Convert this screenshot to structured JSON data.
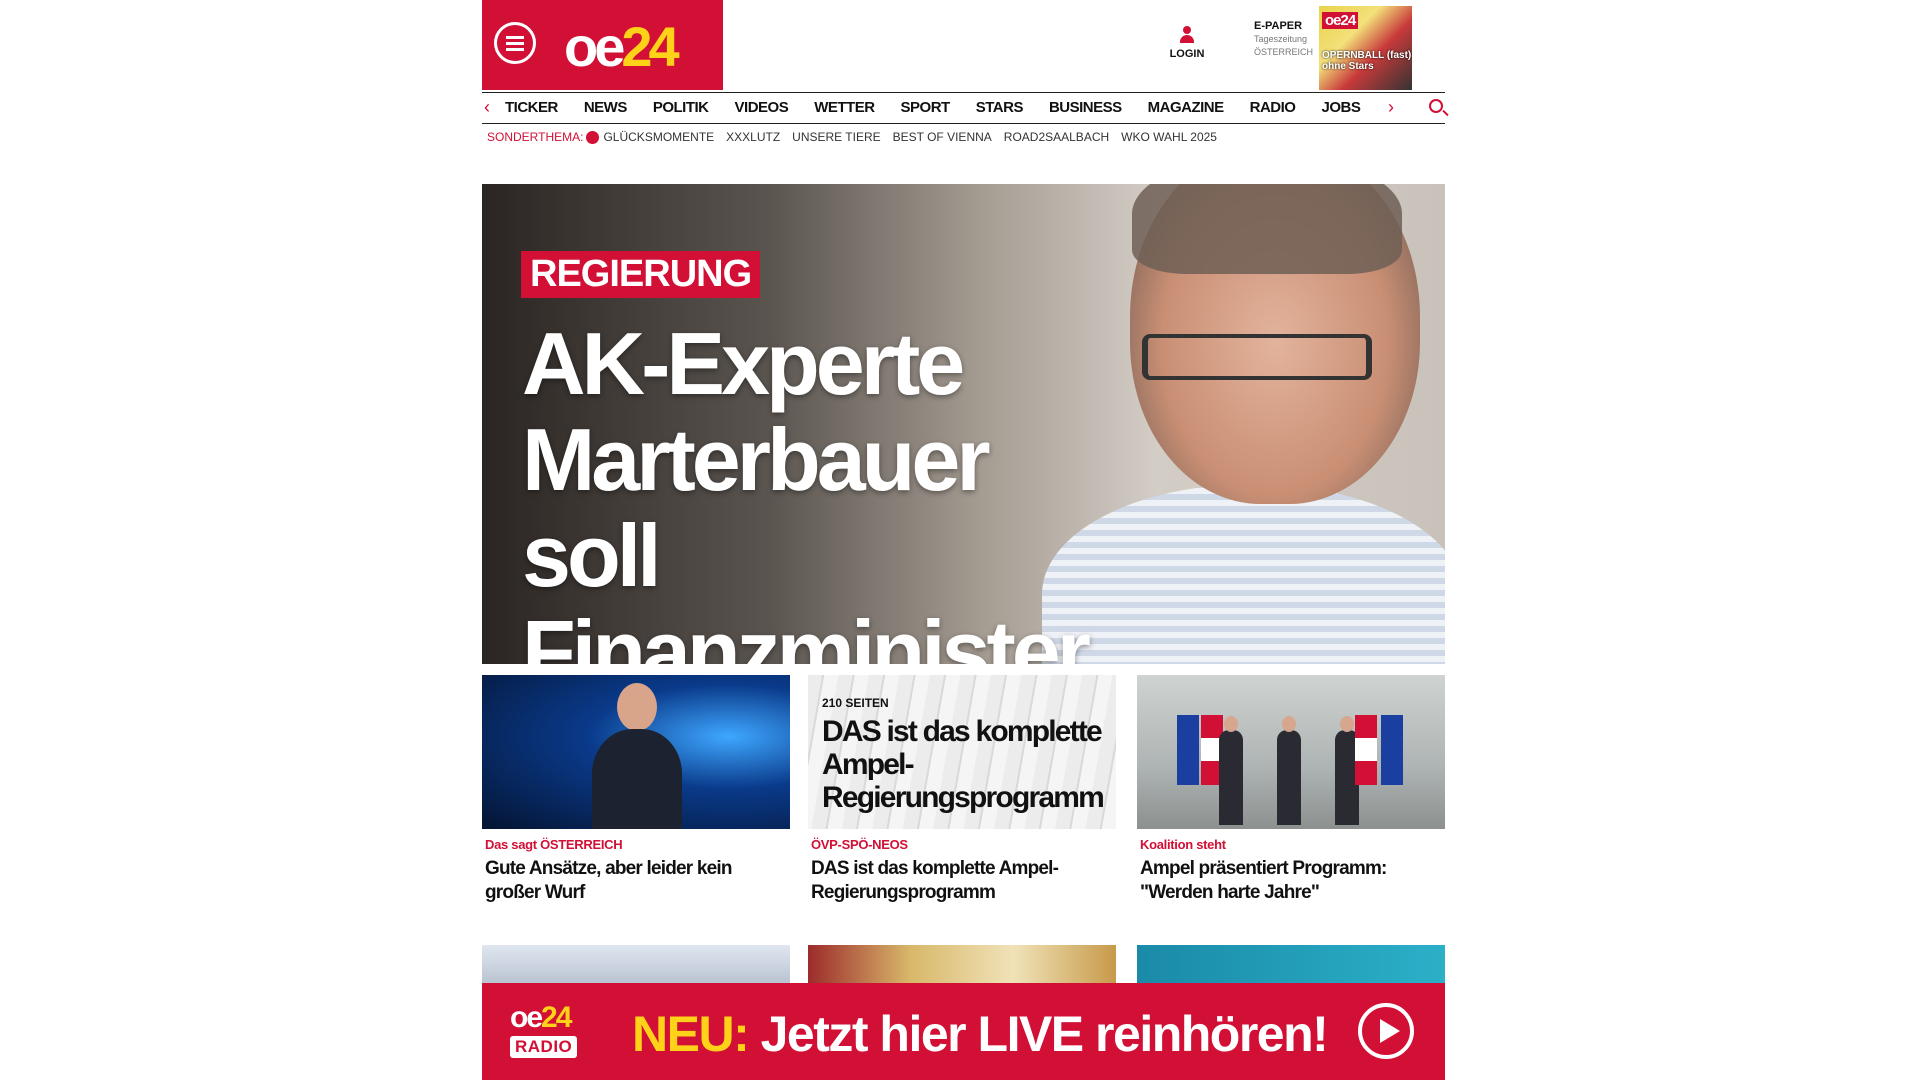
{
  "header": {
    "logo_text_a": "oe",
    "logo_text_b": "24",
    "login_label": "LOGIN",
    "epaper": {
      "title": "E-PAPER",
      "line1": "Tageszeitung",
      "line2": "ÖSTERREICH"
    },
    "cover": {
      "logo": "oe24",
      "headline": "OPERNBALL (fast) ohne Stars"
    }
  },
  "nav": {
    "items": [
      "TICKER",
      "NEWS",
      "POLITIK",
      "VIDEOS",
      "WETTER",
      "SPORT",
      "STARS",
      "BUSINESS",
      "MAGAZINE",
      "RADIO",
      "JOBS"
    ],
    "left_arrow": "‹",
    "right_arrow": "›"
  },
  "subnav": {
    "label": "SONDERTHEMA:",
    "items": [
      "GLÜCKSMOMENTE",
      "XXXLUTZ",
      "UNSERE TIERE",
      "BEST OF VIENNA",
      "ROAD2SAALBACH",
      "WKO WAHL 2025"
    ]
  },
  "hero": {
    "tag": "REGIERUNG",
    "title": "AK-Experte Marterbauer soll Finanzminister werden"
  },
  "cards": [
    {
      "kicker": "Das sagt ÖSTERREICH",
      "headline": "Gute Ansätze, aber leider kein großer Wurf"
    },
    {
      "kicker": "ÖVP-SPÖ-NEOS",
      "headline": "DAS ist das komplette Ampel-Regierungsprogramm",
      "image_small": "210 SEITEN",
      "image_big": "DAS ist das komplette Ampel-Regierungsprogramm"
    },
    {
      "kicker": "Koalition steht",
      "headline": "Ampel präsentiert Programm: \"Werden harte Jahre\""
    }
  ],
  "radio_banner": {
    "logo_a": "oe",
    "logo_b": "24",
    "logo_sub": "RADIO",
    "new_label": "NEU:",
    "message": "Jetzt hier LIVE reinhören!"
  },
  "colors": {
    "brand_red": "#d20f35",
    "brand_yellow": "#ffd21a"
  }
}
